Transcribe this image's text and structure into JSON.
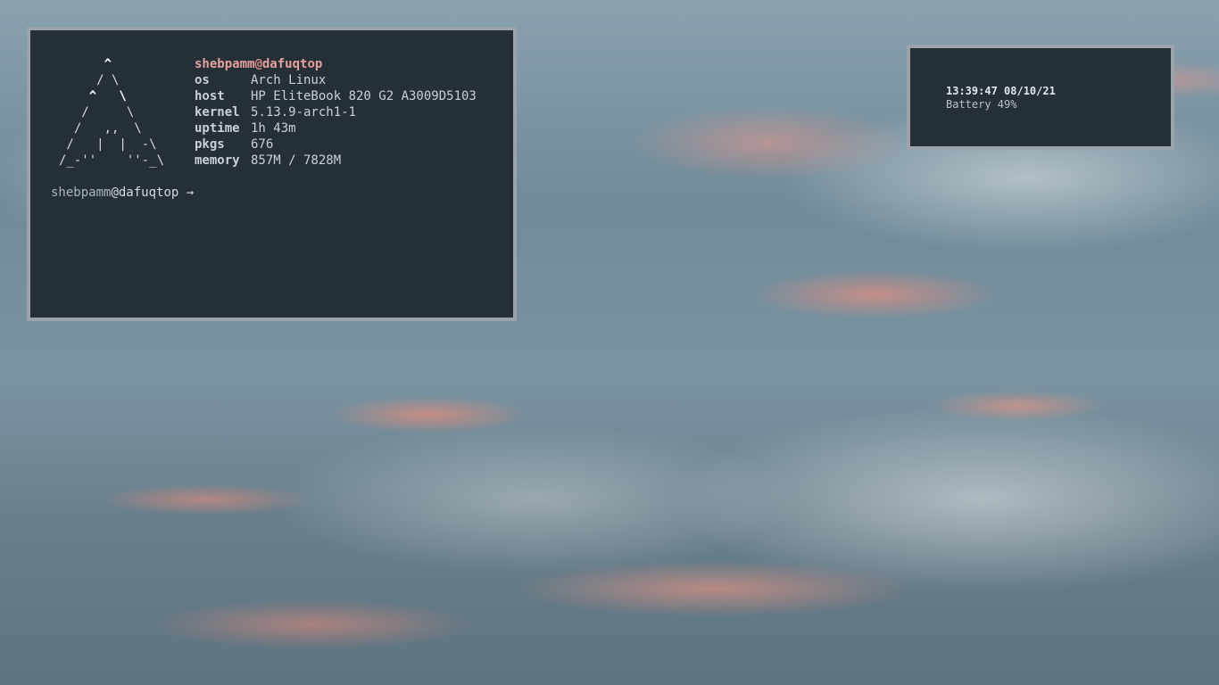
{
  "terminal": {
    "ascii_logo": [
      "      ^",
      "     / \\",
      "    ^   \\",
      "   /     \\",
      "  /   ,,  \\",
      " /   |  |  -\\",
      "/_-''    ''-_\\"
    ],
    "user": "shebpamm",
    "at": "@",
    "host": "dafuqtop",
    "info": [
      {
        "key": "os",
        "value": "Arch Linux"
      },
      {
        "key": "host",
        "value": "HP EliteBook 820 G2 A3009D5103"
      },
      {
        "key": "kernel",
        "value": "5.13.9-arch1-1"
      },
      {
        "key": "uptime",
        "value": "1h 43m"
      },
      {
        "key": "pkgs",
        "value": "676"
      },
      {
        "key": "memory",
        "value": "857M / 7828M"
      }
    ],
    "prompt": {
      "user": "shebpamm",
      "at": "@",
      "host": "dafuqtop",
      "arrow": " →"
    }
  },
  "status_widget": {
    "datetime": "13:39:47 08/10/21",
    "battery": "Battery 49%"
  },
  "colors": {
    "window_bg": "#252f36",
    "window_border": "#9aa3aa",
    "username_accent": "#e6a0a0"
  }
}
